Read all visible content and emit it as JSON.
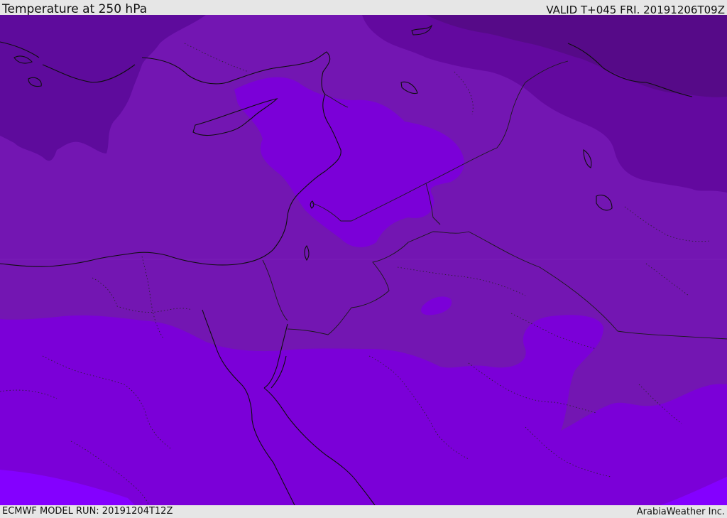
{
  "header": {
    "title": "Temperature at 250 hPa",
    "valid": "VALID T+045 FRI. 20191206T09Z"
  },
  "footer": {
    "model_run": "ECMWF MODEL RUN: 20191204T12Z",
    "credit": "ArabiaWeather Inc."
  },
  "map": {
    "variable": "temperature",
    "level": "250 hPa",
    "colors": {
      "coldest": "#5b0a96",
      "cold": "#6a0aa8",
      "mid": "#7414b0",
      "warm": "#7c00dc",
      "warmest": "#8400ff",
      "coast": "#101010",
      "border": "#1a1a1a"
    }
  }
}
